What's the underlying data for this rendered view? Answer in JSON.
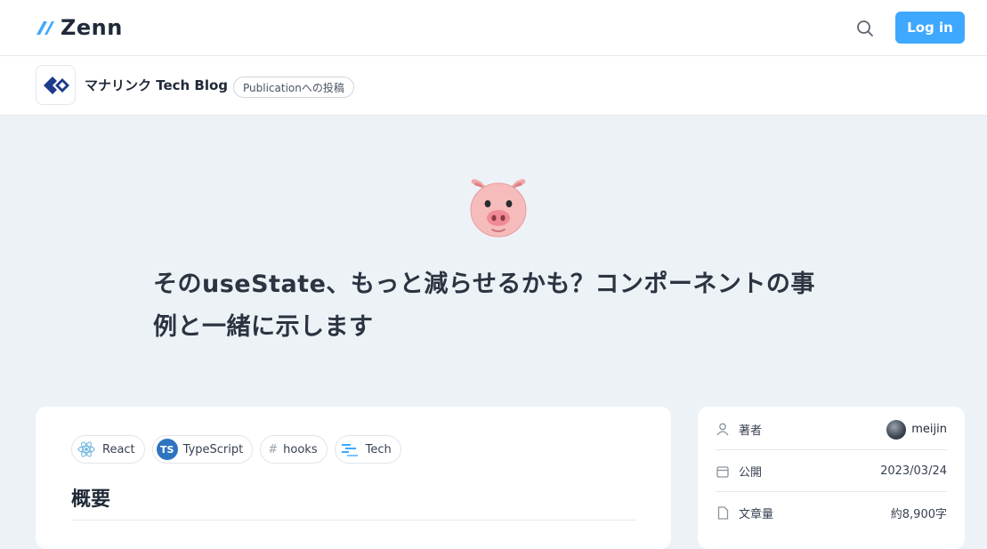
{
  "header": {
    "logo_text": "Zenn",
    "search_icon": "search-icon",
    "login_label": "Log in",
    "accent_color": "#3ea8ff"
  },
  "publication": {
    "name": "マナリンク Tech Blog",
    "badge": "Publicationへの投稿"
  },
  "article": {
    "emoji": "pig-face",
    "title": "そのuseState、もっと減らせるかも？コンポーネントの事例と一緒に示します",
    "topics": [
      {
        "label": "React",
        "icon": "react-icon"
      },
      {
        "label": "TypeScript",
        "icon": "typescript-icon"
      },
      {
        "label": "hooks",
        "icon": "hash-icon"
      },
      {
        "label": "Tech",
        "icon": "tech-icon"
      }
    ],
    "first_heading": "概要"
  },
  "sidebar": {
    "author_label": "著者",
    "author_name": "meijin",
    "published_label": "公開",
    "published_date": "2023/03/24",
    "length_label": "文章量",
    "length_value": "約8,900字"
  }
}
